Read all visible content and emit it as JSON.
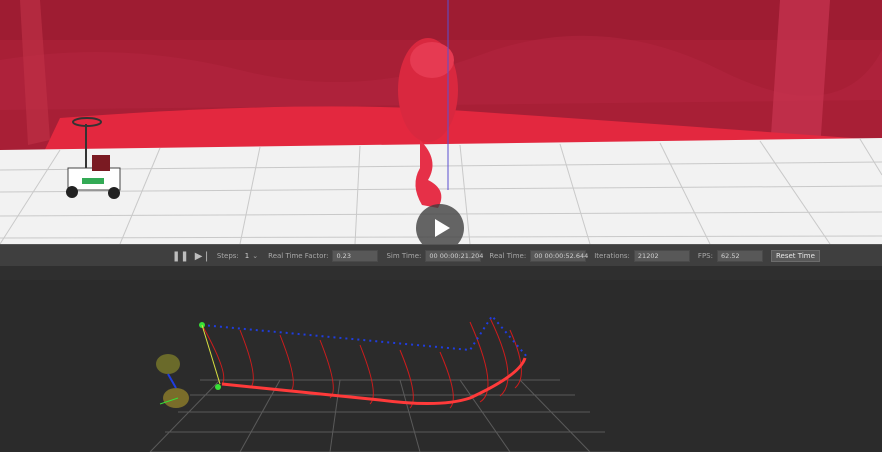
{
  "simulator": {
    "toolbar": {
      "steps_label": "Steps:",
      "steps_value": "1",
      "rtf_label": "Real Time Factor:",
      "rtf_value": "0.23",
      "sim_time_label": "Sim Time:",
      "sim_time_value": "00 00:00:21.204",
      "real_time_label": "Real Time:",
      "real_time_value": "00 00:00:52.644",
      "iterations_label": "Iterations:",
      "iterations_value": "21202",
      "fps_label": "FPS:",
      "fps_value": "62.52",
      "reset_label": "Reset Time"
    },
    "icons": [
      "pause-icon",
      "step-icon",
      "play-icon"
    ],
    "colors": {
      "wall": "#a81f36",
      "floor": "#f2f2f2",
      "toolbar_bg": "#3f3f3f",
      "viz_bg": "#2b2b2b",
      "trajectory": "#e01b1b",
      "waypoints": "#1f3de0"
    }
  }
}
